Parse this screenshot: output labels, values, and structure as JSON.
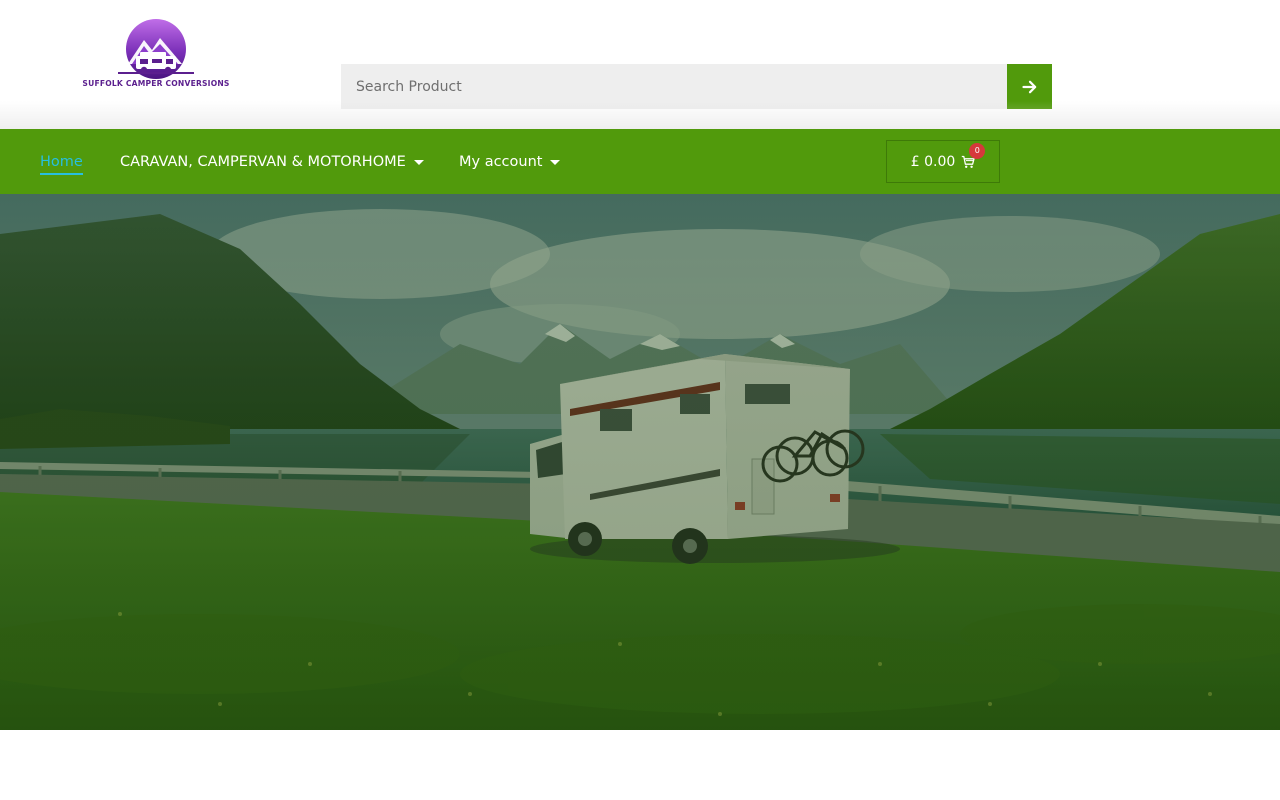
{
  "brand": {
    "name": "SUFFOLK CAMPER CONVERSIONS",
    "logo_icon": "campervan-mountain-logo",
    "colors": {
      "primary": "#519a0c",
      "logo_purple": "#5b1f8e",
      "active_link": "#27bfe0",
      "badge": "#d6393b"
    }
  },
  "search": {
    "placeholder": "Search Product",
    "submit_icon": "arrow-right-icon"
  },
  "nav": {
    "items": [
      {
        "label": "Home",
        "active": true
      },
      {
        "label": "CARAVAN, CAMPERVAN & MOTORHOME",
        "has_dropdown": true
      },
      {
        "label": "My account",
        "has_dropdown": true
      }
    ]
  },
  "cart": {
    "amount": "£ 0.00",
    "count": "0",
    "icon": "cart-icon"
  },
  "hero": {
    "image": "campervan-fjord-landscape"
  }
}
